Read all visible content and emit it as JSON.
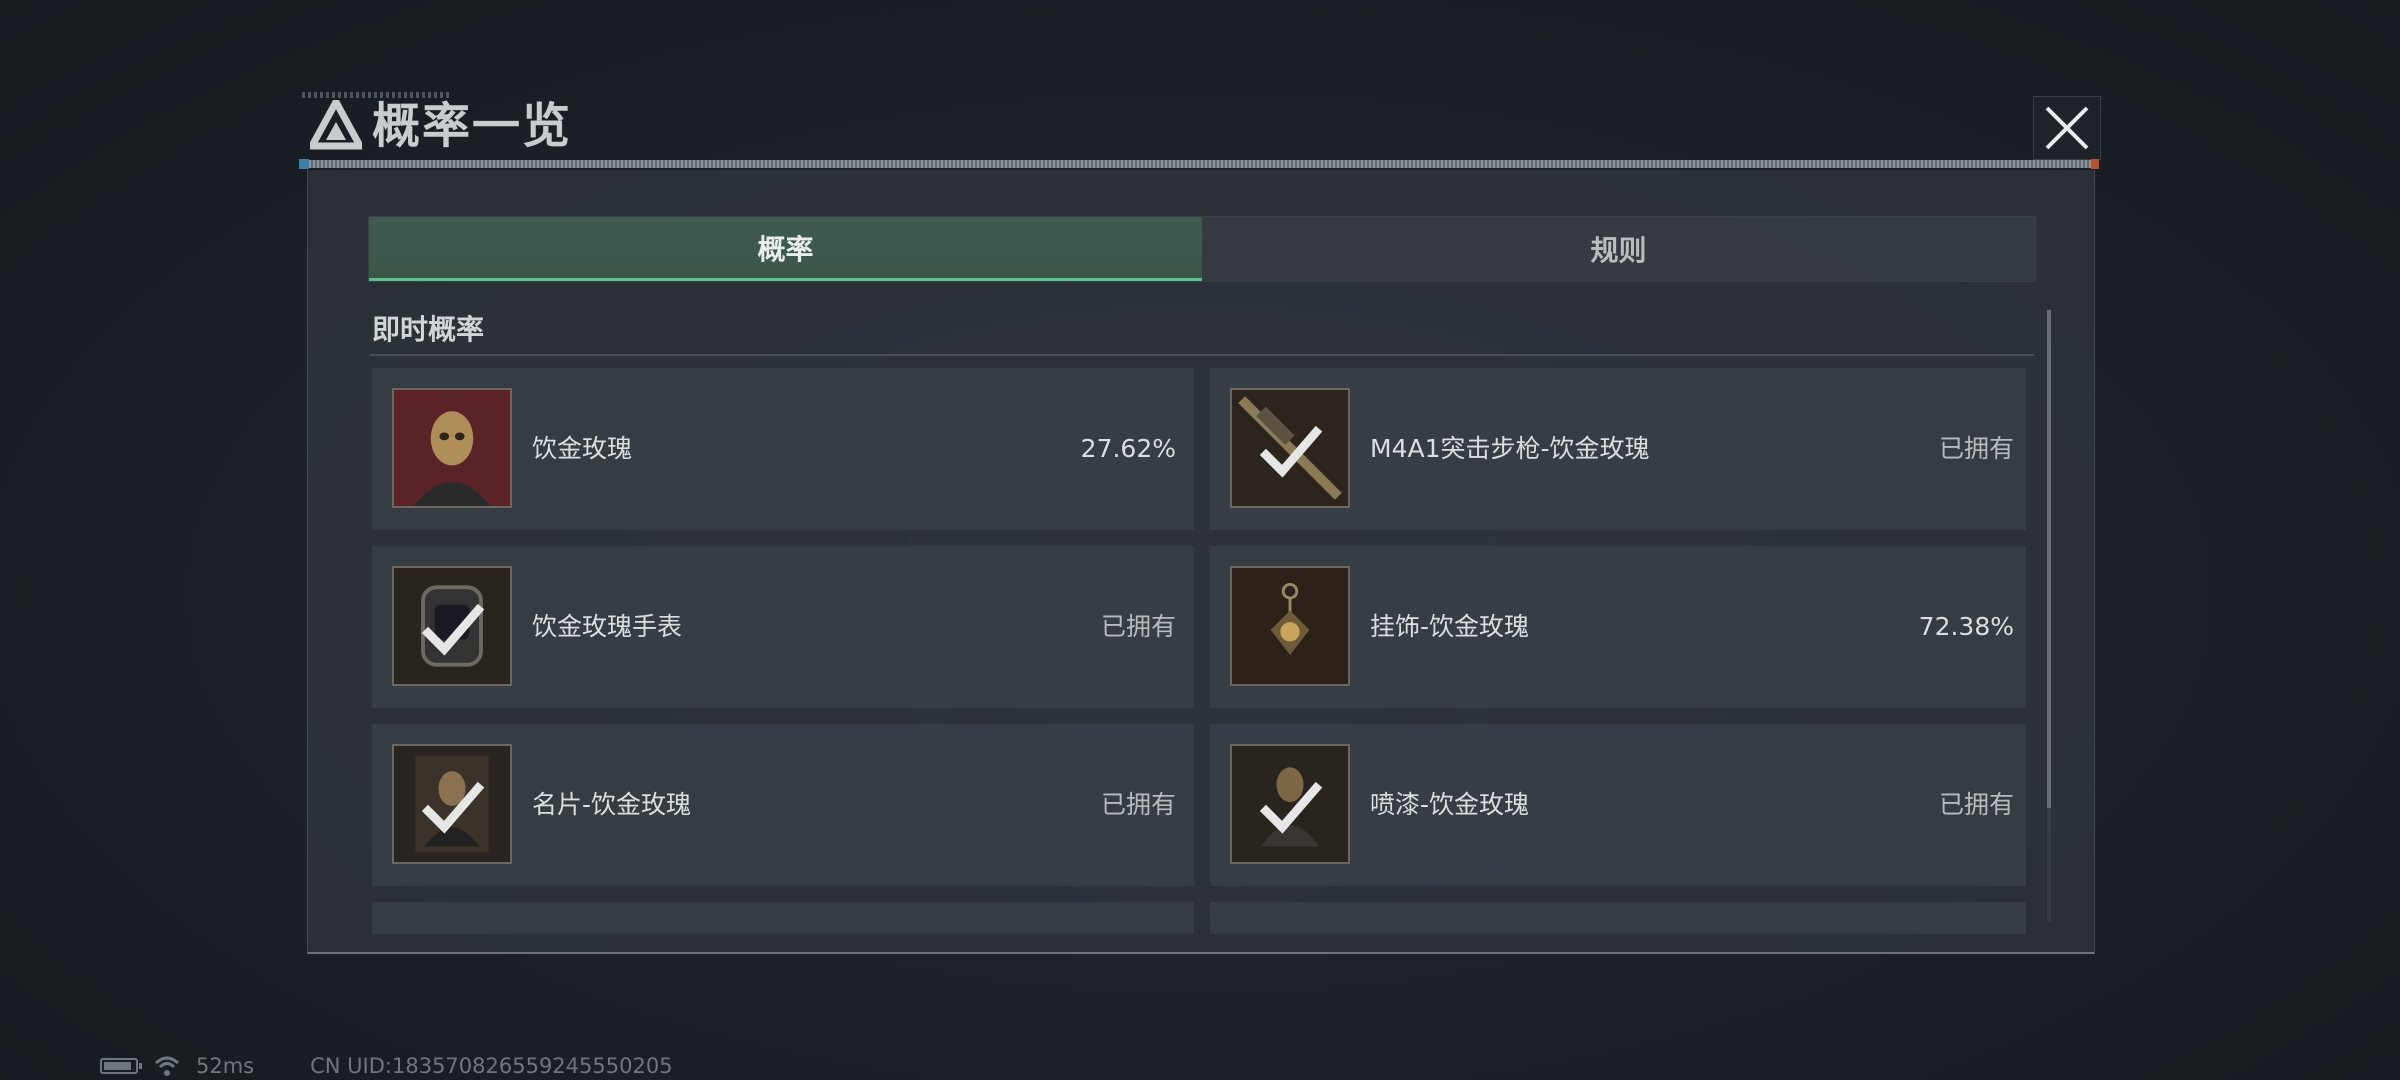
{
  "dialog": {
    "title": "概率一览"
  },
  "tabs": [
    {
      "label": "概率",
      "active": true
    },
    {
      "label": "规则",
      "active": false
    }
  ],
  "section": {
    "title": "即时概率"
  },
  "items": [
    {
      "name": "饮金玫瑰",
      "value": "27.62%",
      "owned": false,
      "icon": "operator-portrait-icon"
    },
    {
      "name": "M4A1突击步枪-饮金玫瑰",
      "value": "已拥有",
      "owned": true,
      "icon": "rifle-icon"
    },
    {
      "name": "饮金玫瑰手表",
      "value": "已拥有",
      "owned": true,
      "icon": "watch-icon"
    },
    {
      "name": "挂饰-饮金玫瑰",
      "value": "72.38%",
      "owned": false,
      "icon": "charm-icon"
    },
    {
      "name": "名片-饮金玫瑰",
      "value": "已拥有",
      "owned": true,
      "icon": "name-card-icon"
    },
    {
      "name": "喷漆-饮金玫瑰",
      "value": "已拥有",
      "owned": true,
      "icon": "spray-icon"
    }
  ],
  "status_bar": {
    "battery_level": 0.9,
    "ping": "52ms",
    "uid": "CN UID:183570826559245550205"
  },
  "colors": {
    "active_tab": "#3f5a50",
    "active_underline": "#57c28c",
    "panel": "#2e353b"
  }
}
